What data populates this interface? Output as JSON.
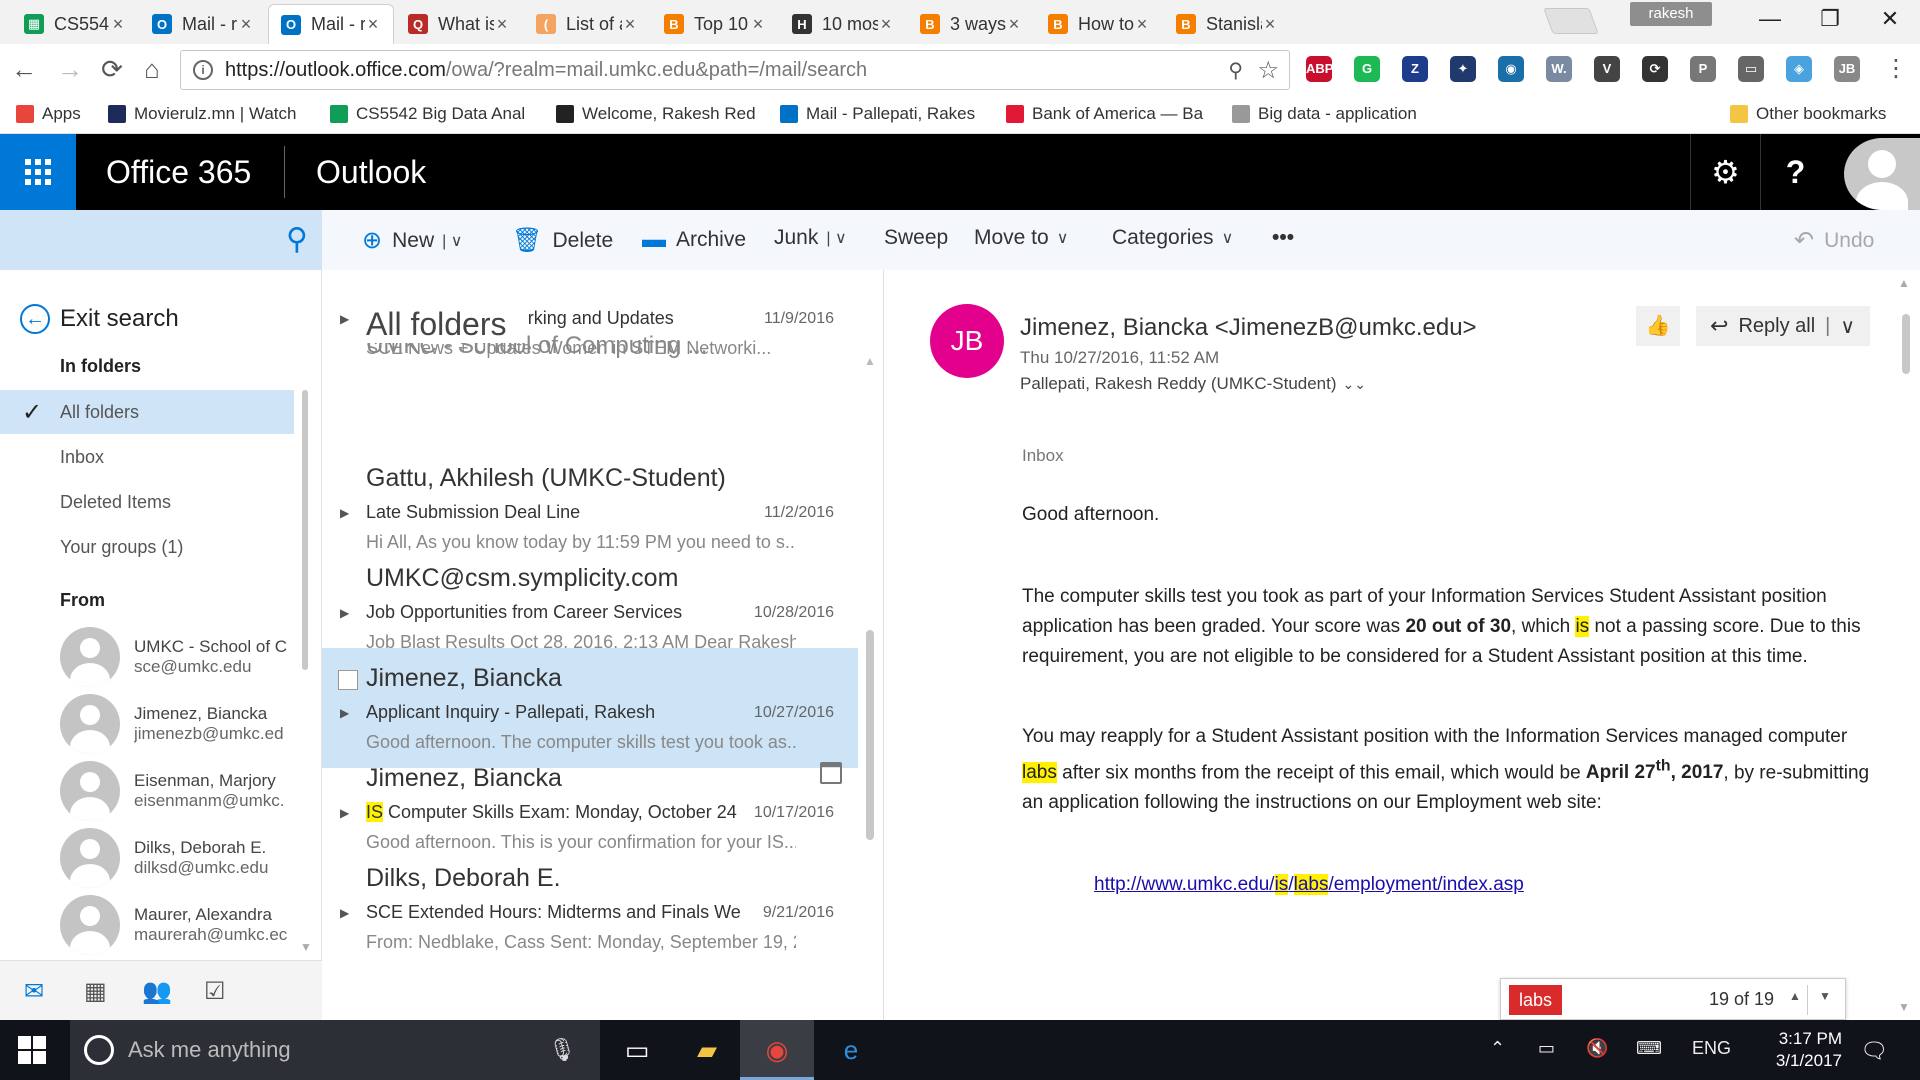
{
  "browser": {
    "tabs": [
      {
        "title": "CS5542",
        "favicon_color": "#0f9d58",
        "favicon_char": "▦"
      },
      {
        "title": "Mail - r",
        "favicon_color": "#0072c6",
        "favicon_char": "O"
      },
      {
        "title": "Mail - r",
        "favicon_color": "#0072c6",
        "favicon_char": "O",
        "active": true
      },
      {
        "title": "What is",
        "favicon_color": "#b92b27",
        "favicon_char": "Q"
      },
      {
        "title": "List of a",
        "favicon_color": "#f4a460",
        "favicon_char": "("
      },
      {
        "title": "Top 10",
        "favicon_color": "#f57d00",
        "favicon_char": "B"
      },
      {
        "title": "10 mos",
        "favicon_color": "#333333",
        "favicon_char": "H"
      },
      {
        "title": "3 ways",
        "favicon_color": "#f57d00",
        "favicon_char": "B"
      },
      {
        "title": "How to",
        "favicon_color": "#f57d00",
        "favicon_char": "B"
      },
      {
        "title": "Stanisla",
        "favicon_color": "#f57d00",
        "favicon_char": "B"
      }
    ],
    "profile": "rakesh",
    "url_host": "https://outlook.office.com",
    "url_rest": "/owa/?realm=mail.umkc.edu&path=/mail/search",
    "extensions": [
      {
        "label": "ABP",
        "color": "#c8102e",
        "badge": "2"
      },
      {
        "label": "G",
        "color": "#1db954",
        "badge": "NEW"
      },
      {
        "label": "Z",
        "color": "#1e3c8c"
      },
      {
        "label": "✦",
        "color": "#203a6e"
      },
      {
        "label": "◉",
        "color": "#1b6fa8"
      },
      {
        "label": "W.",
        "color": "#7a8aa0"
      },
      {
        "label": "V",
        "color": "#444444"
      },
      {
        "label": "⟳",
        "color": "#333333"
      },
      {
        "label": "P",
        "color": "#777777"
      },
      {
        "label": "▭",
        "color": "#666666"
      },
      {
        "label": "◈",
        "color": "#4aa3df"
      },
      {
        "label": "JB",
        "color": "#888888"
      }
    ],
    "bookmarks": [
      {
        "label": "Apps",
        "color": "#e8453c"
      },
      {
        "label": "Movierulz.mn | Watch",
        "color": "#1d2b5a"
      },
      {
        "label": "CS5542 Big Data Anal",
        "color": "#0f9d58"
      },
      {
        "label": "Welcome, Rakesh Red",
        "color": "#222222"
      },
      {
        "label": "Mail - Pallepati, Rakes",
        "color": "#0072c6"
      },
      {
        "label": "Bank of America — Ba",
        "color": "#e31837"
      },
      {
        "label": "Big data - application",
        "color": "#999999"
      }
    ],
    "other_bookmarks": "Other bookmarks"
  },
  "header": {
    "suite": "Office 365",
    "app": "Outlook",
    "settings_icon": "gear-icon",
    "help_label": "?"
  },
  "toolbar": {
    "new_label": "New",
    "delete_label": "Delete",
    "archive_label": "Archive",
    "junk_label": "Junk",
    "sweep_label": "Sweep",
    "move_label": "Move to",
    "categories_label": "Categories",
    "more_label": "•••",
    "undo_label": "Undo"
  },
  "leftpane": {
    "exit_search": "Exit search",
    "in_folders_heading": "In folders",
    "folders": [
      {
        "label": "All folders",
        "selected": true
      },
      {
        "label": "Inbox"
      },
      {
        "label": "Deleted Items"
      },
      {
        "label": "Your groups (1)"
      }
    ],
    "from_heading": "From",
    "people": [
      {
        "name": "UMKC - School of C",
        "email": "sce@umkc.edu"
      },
      {
        "name": "Jimenez, Biancka",
        "email": "jimenezb@umkc.ed"
      },
      {
        "name": "Eisenman, Marjory",
        "email": "eisenmanm@umkc."
      },
      {
        "name": "Dilks, Deborah E.",
        "email": "dilksd@umkc.edu"
      },
      {
        "name": "Maurer, Alexandra",
        "email": "maurerah@umkc.ec"
      }
    ]
  },
  "list": {
    "title": "All folders",
    "partial_sender": "UMKC - School of Computing ...",
    "messages": [
      {
        "sender": "",
        "subject": "SCE Weekly: Networking and Updates",
        "date": "11/9/2016",
        "preview": "SCE News + Updates        Women in STEM Networki..."
      },
      {
        "sender": "Gattu, Akhilesh (UMKC-Student)",
        "subject": "Late Submission Deal Line",
        "date": "11/2/2016",
        "preview": "Hi All,    As you know today by 11:59 PM you need to s..."
      },
      {
        "sender": "UMKC@csm.symplicity.com",
        "subject": "Job Opportunities from Career Services",
        "date": "10/28/2016",
        "preview": "Job Blast Results  Oct 28, 2016, 2:13 AM   Dear Rakesh"
      },
      {
        "sender": "Jimenez, Biancka",
        "subject": "Applicant Inquiry - Pallepati, Rakesh",
        "date": "10/27/2016",
        "preview": "Good afternoon.  The computer skills test you took as...",
        "selected": true
      },
      {
        "sender": "Jimenez, Biancka",
        "subject_hl": "IS",
        "subject": " Computer Skills Exam: Monday, October 24",
        "date": "10/17/2016",
        "preview": "Good afternoon.  This is your confirmation for your IS..."
      },
      {
        "sender": "Dilks, Deborah E.",
        "subject": "SCE Extended Hours: Midterms and Finals We",
        "date": "9/21/2016",
        "preview": "From: Nedblake, Cass Sent: Monday, September 19, 2..."
      }
    ]
  },
  "reading": {
    "initials": "JB",
    "avatar_color": "#e3008c",
    "from": "Jimenez, Biancka <JimenezB@umkc.edu>",
    "date": "Thu 10/27/2016, 11:52 AM",
    "to": "Pallepati, Rakesh Reddy (UMKC-Student)",
    "reply_all": "Reply all",
    "folder_label": "Inbox",
    "greeting": "Good afternoon.",
    "p1_a": "The computer skills test you took as part of your Information Services Student Assistant position application has been graded. Your score was ",
    "p1_score": "20 out of 30",
    "p1_b": ", which ",
    "p1_hl": "is",
    "p1_c": " not a passing score. Due to this requirement, you are not eligible to be considered for a Student Assistant position at this time.",
    "p2_a": "You may reapply for a Student Assistant position with the Information Services managed computer ",
    "p2_hl": "labs",
    "p2_b": " after six months from the receipt of this email, which would be ",
    "p2_date": "April 27",
    "p2_sup": "th",
    "p2_year": ", 2017",
    "p2_c": ", by re-submitting an application following the instructions on our Employment web site:",
    "link_a": "http://www.umkc.edu/",
    "link_hl1": "is",
    "link_b": "/",
    "link_hl2": "labs",
    "link_c": "/employment/index.asp"
  },
  "findbar": {
    "query": "labs",
    "count": "19 of 19"
  },
  "taskbar": {
    "search_placeholder": "Ask me anything",
    "language": "ENG",
    "time": "3:17 PM",
    "date": "3/1/2017"
  }
}
